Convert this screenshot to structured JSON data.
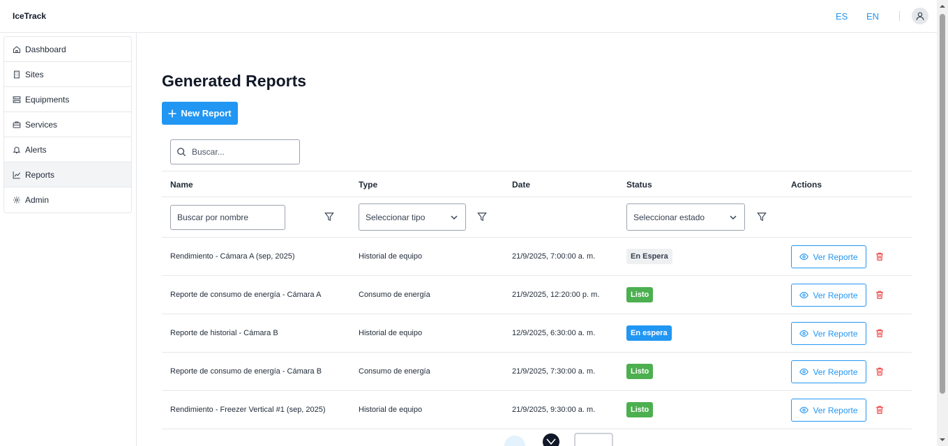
{
  "app": {
    "brand": "IceTrack"
  },
  "header": {
    "lang_es": "ES",
    "lang_en": "EN",
    "avatar_icon": "user-icon"
  },
  "sidebar": {
    "items": [
      {
        "label": "Dashboard",
        "icon": "home-icon"
      },
      {
        "label": "Sites",
        "icon": "building-icon"
      },
      {
        "label": "Equipments",
        "icon": "server-icon"
      },
      {
        "label": "Services",
        "icon": "briefcase-icon"
      },
      {
        "label": "Alerts",
        "icon": "bell-icon"
      },
      {
        "label": "Reports",
        "icon": "chart-line-icon",
        "active": true
      },
      {
        "label": "Admin",
        "icon": "gear-icon"
      }
    ]
  },
  "main": {
    "title": "Generated Reports",
    "new_button": "New Report",
    "search_placeholder": "Buscar..."
  },
  "table": {
    "headers": {
      "name": "Name",
      "type": "Type",
      "date": "Date",
      "status": "Status",
      "actions": "Actions"
    },
    "filters": {
      "name_placeholder": "Buscar por nombre",
      "type_placeholder": "Seleccionar tipo",
      "status_placeholder": "Seleccionar estado"
    },
    "action_label": "Ver Reporte",
    "rows": [
      {
        "name": "Rendimiento - Cámara A (sep, 2025)",
        "type": "Historial de equipo",
        "date": "21/9/2025, 7:00:00 a. m.",
        "status": "En Espera",
        "status_kind": "pending-grey"
      },
      {
        "name": "Reporte de consumo de energía - Cámara A",
        "type": "Consumo de energía",
        "date": "21/9/2025, 12:20:00 p. m.",
        "status": "Listo",
        "status_kind": "ready"
      },
      {
        "name": "Reporte de historial - Cámara B",
        "type": "Historial de equipo",
        "date": "12/9/2025, 6:30:00 a. m.",
        "status": "En espera",
        "status_kind": "pending-blue"
      },
      {
        "name": "Reporte de consumo de energía - Cámara B",
        "type": "Consumo de energía",
        "date": "21/9/2025, 7:30:00 a. m.",
        "status": "Listo",
        "status_kind": "ready"
      },
      {
        "name": "Rendimiento - Freezer Vertical #1 (sep, 2025)",
        "type": "Historial de equipo",
        "date": "21/9/2025, 9:30:00 a. m.",
        "status": "Listo",
        "status_kind": "ready"
      }
    ]
  },
  "colors": {
    "accent": "#2196f3",
    "ready": "#4caf50",
    "pending_grey_bg": "#eef0f2",
    "danger": "#ef4444"
  }
}
